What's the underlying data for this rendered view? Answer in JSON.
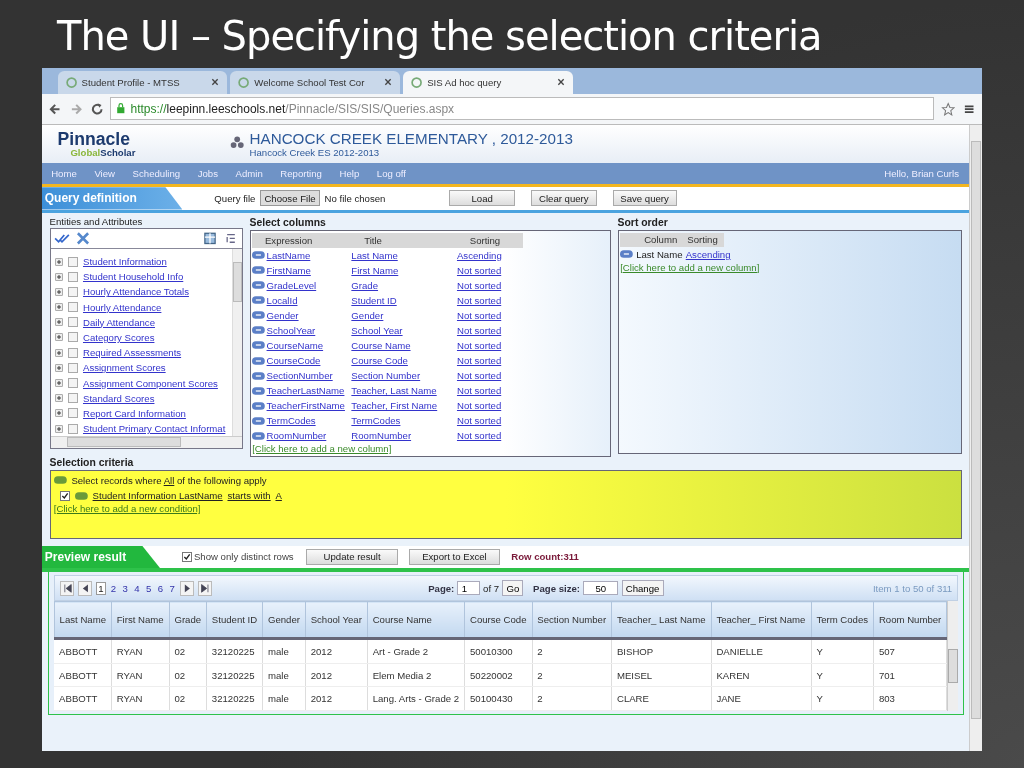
{
  "slide": {
    "title": "The UI – Specifying the selection criteria"
  },
  "browser": {
    "tabs": [
      {
        "label": "Student Profile - MTSS",
        "selected": false
      },
      {
        "label": "Welcome School Test Cor",
        "selected": false
      },
      {
        "label": "SIS Ad hoc query",
        "selected": true
      }
    ],
    "url": {
      "scheme": "https://",
      "host": "leepinn.leeschools.net",
      "path": "/Pinnacle/SIS/SIS/Queries.aspx"
    }
  },
  "header": {
    "logo_top": "Pinnacle",
    "logo_bottom_a": "Global",
    "logo_bottom_b": "Scholar",
    "school": "HANCOCK CREEK ELEMENTARY , 2012-2013",
    "school_sub": "Hancock Creek ES 2012-2013"
  },
  "menu": {
    "items": [
      "Home",
      "View",
      "Scheduling",
      "Jobs",
      "Admin",
      "Reporting",
      "Help",
      "Log off"
    ],
    "greeting": "Hello, Brian Curls"
  },
  "query_bar": {
    "title": "Query definition",
    "file_label": "Query file",
    "file_button": "Choose File",
    "file_status": "No file chosen",
    "buttons": [
      "Load",
      "Clear query",
      "Save query"
    ]
  },
  "entities": {
    "heading": "Entities and Attributes",
    "items": [
      {
        "label": "Student Information",
        "checked": false
      },
      {
        "label": "Student Household Info",
        "checked": false
      },
      {
        "label": "Hourly Attendance Totals",
        "checked": false
      },
      {
        "label": "Hourly Attendance",
        "checked": false
      },
      {
        "label": "Daily Attendance",
        "checked": false
      },
      {
        "label": "Category Scores",
        "checked": false
      },
      {
        "label": "Required Assessments",
        "checked": false
      },
      {
        "label": "Assignment Scores",
        "checked": false
      },
      {
        "label": "Assignment Component Scores",
        "checked": false
      },
      {
        "label": "Standard Scores",
        "checked": false
      },
      {
        "label": "Report Card Information",
        "checked": false
      },
      {
        "label": "Student Primary Contact Informat",
        "checked": false
      }
    ]
  },
  "select_columns": {
    "heading": "Select columns",
    "columns": [
      "Expression",
      "Title",
      "Sorting"
    ],
    "rows": [
      {
        "expression": "LastName",
        "title": "Last Name",
        "sorting": "Ascending"
      },
      {
        "expression": "FirstName",
        "title": "First Name",
        "sorting": "Not sorted"
      },
      {
        "expression": "GradeLevel",
        "title": "Grade",
        "sorting": "Not sorted"
      },
      {
        "expression": "LocalId",
        "title": "Student ID",
        "sorting": "Not sorted"
      },
      {
        "expression": "Gender",
        "title": "Gender",
        "sorting": "Not sorted"
      },
      {
        "expression": "SchoolYear",
        "title": "School Year",
        "sorting": "Not sorted"
      },
      {
        "expression": "CourseName",
        "title": "Course Name",
        "sorting": "Not sorted"
      },
      {
        "expression": "CourseCode",
        "title": "Course Code",
        "sorting": "Not sorted"
      },
      {
        "expression": "SectionNumber",
        "title": "Section Number",
        "sorting": "Not sorted"
      },
      {
        "expression": "TeacherLastName",
        "title": "Teacher, Last Name",
        "sorting": "Not sorted"
      },
      {
        "expression": "TeacherFirstName",
        "title": "Teacher, First Name",
        "sorting": "Not sorted"
      },
      {
        "expression": "TermCodes",
        "title": "TermCodes",
        "sorting": "Not sorted"
      },
      {
        "expression": "RoomNumber",
        "title": "RoomNumber",
        "sorting": "Not sorted"
      }
    ],
    "add_link": "[Click here to add a new column]"
  },
  "sort_order": {
    "heading": "Sort order",
    "columns": [
      "Column",
      "Sorting"
    ],
    "rows": [
      {
        "column": "Last Name",
        "sorting": "Ascending"
      }
    ],
    "add_link": "[Click here to add a new column]"
  },
  "selection_criteria": {
    "heading": "Selection criteria",
    "root": {
      "prefix": "Select records where",
      "mode": "All",
      "suffix": "of the following apply"
    },
    "conditions": [
      {
        "checked": true,
        "field": "Student Information LastName",
        "operator": "starts with",
        "value": "A"
      }
    ],
    "add_link": "[Click here to add a new condition]"
  },
  "preview": {
    "title": "Preview result",
    "distinct": {
      "label": "Show only distinct rows",
      "checked": true
    },
    "buttons": [
      "Update result",
      "Export to Excel"
    ],
    "row_count": "Row count:311"
  },
  "pager": {
    "pages": [
      {
        "label": "1",
        "selected": true
      },
      {
        "label": "2",
        "selected": false
      },
      {
        "label": "3",
        "selected": false
      },
      {
        "label": "4",
        "selected": false
      },
      {
        "label": "5",
        "selected": false
      },
      {
        "label": "6",
        "selected": false
      },
      {
        "label": "7",
        "selected": false
      }
    ],
    "page_label": "Page:",
    "page_value": "1",
    "page_total": "of 7",
    "go": "Go",
    "size_label": "Page size:",
    "size_value": "50",
    "change": "Change",
    "summary": "Item 1 to 50 of 311"
  },
  "table": {
    "columns": [
      "Last Name",
      "First Name",
      "Grade",
      "Student ID",
      "Gender",
      "School Year",
      "Course Name",
      "Course Code",
      "Section Number",
      "Teacher_ Last Name",
      "Teacher_ First Name",
      "Term Codes",
      "Room Number"
    ],
    "rows": [
      [
        "ABBOTT",
        "RYAN",
        "02",
        "32120225",
        "male",
        "2012",
        "Art - Grade 2",
        "50010300",
        "2",
        "BISHOP",
        "DANIELLE",
        "Y",
        "507"
      ],
      [
        "ABBOTT",
        "RYAN",
        "02",
        "32120225",
        "male",
        "2012",
        "Elem Media 2",
        "50220002",
        "2",
        "MEISEL",
        "KAREN",
        "Y",
        "701"
      ],
      [
        "ABBOTT",
        "RYAN",
        "02",
        "32120225",
        "male",
        "2012",
        "Lang. Arts - Grade 2",
        "50100430",
        "2",
        "CLARE",
        "JANE",
        "Y",
        "803"
      ]
    ]
  }
}
